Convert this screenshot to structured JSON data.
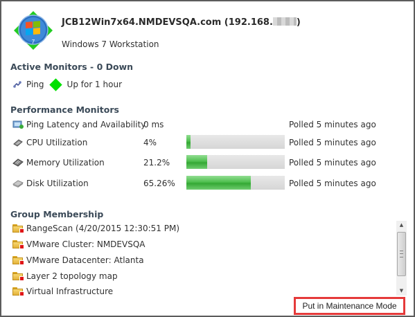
{
  "device": {
    "title_prefix": "JCB12Win7x64.NMDEVSQA.com (192.168.",
    "title_suffix": ")",
    "type": "Windows 7 Workstation",
    "os_icon": "windows-7-logo",
    "os_badge": "7",
    "status_color": "#22cc22"
  },
  "active_monitors": {
    "title": "Active Monitors - 0 Down",
    "items": [
      {
        "icon": "ping-icon",
        "name": "Ping",
        "status_icon": "green-diamond",
        "status": "Up for 1 hour"
      }
    ]
  },
  "performance_monitors": {
    "title": "Performance Monitors",
    "items": [
      {
        "icon": "latency-icon",
        "name": "Ping Latency and Availability",
        "value": "0 ms",
        "percent": null,
        "polled": "Polled 5 minutes ago"
      },
      {
        "icon": "cpu-icon",
        "name": "CPU Utilization",
        "value": "4%",
        "percent": 4,
        "polled": "Polled 5 minutes ago"
      },
      {
        "icon": "memory-icon",
        "name": "Memory Utilization",
        "value": "21.2%",
        "percent": 21.2,
        "polled": "Polled 5 minutes ago"
      },
      {
        "icon": "disk-icon",
        "name": "Disk Utilization",
        "value": "65.26%",
        "percent": 65.26,
        "polled": "Polled 5 minutes ago"
      }
    ]
  },
  "group_membership": {
    "title": "Group Membership",
    "items": [
      {
        "icon": "folder-icon",
        "label": "RangeScan (4/20/2015 12:30:51 PM)"
      },
      {
        "icon": "folder-icon",
        "label": "VMware Cluster: NMDEVSQA"
      },
      {
        "icon": "folder-icon",
        "label": "VMware Datacenter: Atlanta"
      },
      {
        "icon": "folder-icon",
        "label": "Layer 2 topology map"
      },
      {
        "icon": "folder-icon",
        "label": "Virtual Infrastructure"
      }
    ]
  },
  "actions": {
    "maintenance_label": "Put in Maintenance Mode",
    "highlight_color": "#e53a3a"
  },
  "colors": {
    "bar_fill": "#3cae3c",
    "bar_track": "#dcdcdc",
    "section_title": "#3b4a58"
  }
}
